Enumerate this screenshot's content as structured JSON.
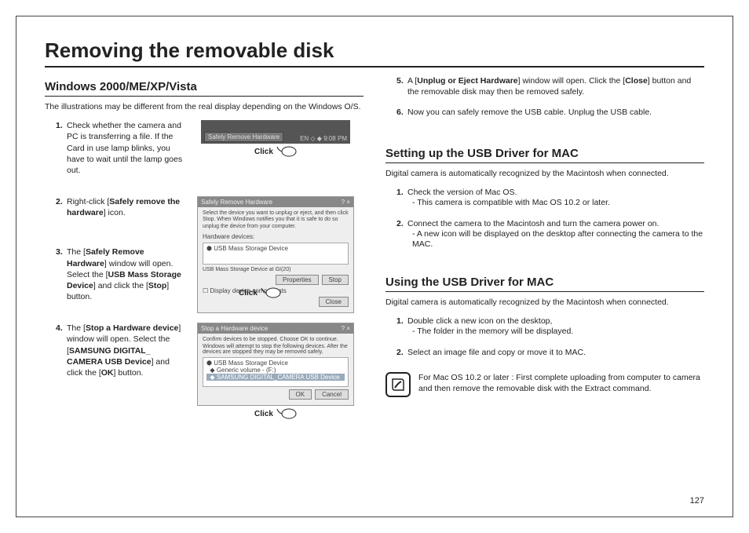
{
  "title": "Removing the removable disk",
  "page_number": "127",
  "left": {
    "heading": "Windows 2000/ME/XP/Vista",
    "intro": "The illustrations may be different from the real display depending on the Windows O/S.",
    "click_label": "Click",
    "step1": {
      "num": "1.",
      "text": "Check whether the camera and PC is transferring a file. If the Card in use lamp blinks, you have to wait until the lamp goes out."
    },
    "step2": {
      "num": "2.",
      "pre": "Right-click [",
      "bold": "Safely remove the hardware",
      "post": "] icon."
    },
    "step3": {
      "num": "3.",
      "p1": "The [",
      "b1": "Safely Remove Hardware",
      "p2": "] window will open. Select the [",
      "b2": "USB Mass Storage Device",
      "p3": "] and click the [",
      "b3": "Stop",
      "p4": "] button."
    },
    "step4": {
      "num": "4.",
      "p1": "The [",
      "b1": "Stop a Hardware device",
      "p2": "] window will open. Select the [",
      "b2": "SAMSUNG  DIGITAL_ CAMERA USB Device",
      "p3": "] and click the [",
      "b3": "OK",
      "p4": "] button."
    },
    "tray_tooltip": "Safely Remove Hardware",
    "tray_time": "9:08 PM",
    "dlg1": {
      "title": "Safely Remove Hardware",
      "desc": "Select the device you want to unplug or eject, and then click Stop. When Windows notifies you that it is safe to do so unplug the device from your computer.",
      "hw_label": "Hardware devices:",
      "item": "USB Mass Storage Device",
      "at": "USB Mass Storage Device at GI(20)",
      "btn_prop": "Properties",
      "btn_stop": "Stop",
      "chk": "Display device components",
      "btn_close": "Close"
    },
    "dlg2": {
      "title": "Stop a Hardware device",
      "desc": "Confirm devices to be stopped. Choose OK to continue.",
      "desc2": "Windows will attempt to stop the following devices. After the devices are stopped they may be removed safely.",
      "i1": "USB Mass Storage Device",
      "i2": "Generic volume - (F:)",
      "i3": "SAMSUNG DIGITAL_CAMERA USB Device",
      "btn_ok": "OK",
      "btn_cancel": "Cancel"
    }
  },
  "right": {
    "step5": {
      "num": "5.",
      "p1": "A [",
      "b1": "Unplug or Eject Hardware",
      "p2": "] window will open. Click the [",
      "b2": "Close",
      "p3": "] button and the removable disk may then be removed safely."
    },
    "step6": {
      "num": "6.",
      "text": "Now you can safely remove the USB cable. Unplug the USB cable."
    },
    "sec1_heading": "Setting up the USB Driver for MAC",
    "sec1_intro": "Digital camera is automatically recognized by the Macintosh when connected.",
    "sec1_s1": {
      "num": "1.",
      "text": "Check the version of Mac OS.",
      "sub": "- This camera is compatible with Mac OS 10.2 or later."
    },
    "sec1_s2": {
      "num": "2.",
      "text": "Connect the camera to the Macintosh and turn the camera power on.",
      "sub": "- A new icon will be displayed on the desktop after connecting the camera to the MAC."
    },
    "sec2_heading": "Using the USB Driver for MAC",
    "sec2_intro": "Digital camera is automatically recognized by the Macintosh when connected.",
    "sec2_s1": {
      "num": "1.",
      "text": "Double click a new icon on the desktop,",
      "sub": "- The folder in the memory will be displayed."
    },
    "sec2_s2": {
      "num": "2.",
      "text": "Select an image file and copy or move it to MAC."
    },
    "note": "For Mac OS 10.2 or later : First complete uploading from computer to camera and then remove the removable disk with the Extract command."
  }
}
